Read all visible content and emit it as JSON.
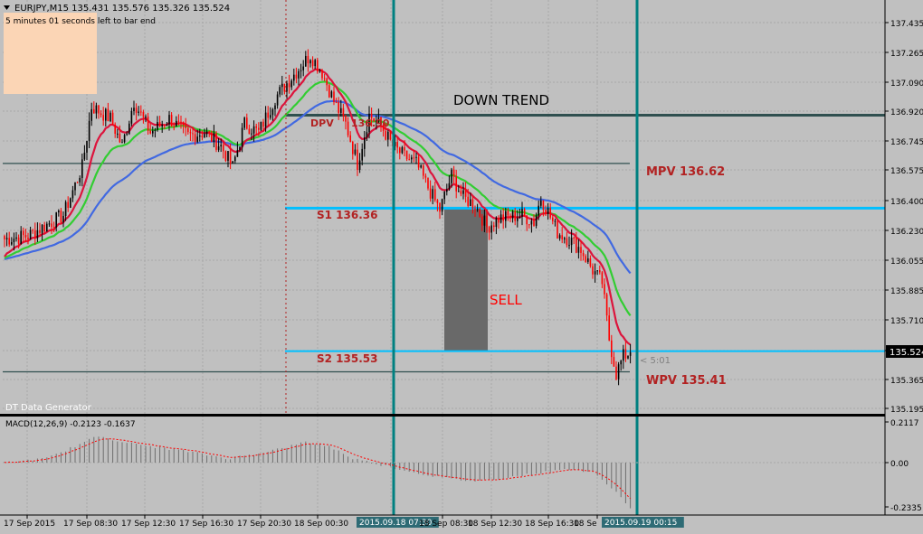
{
  "header": {
    "symbol_line": "EURJPY,M15  135.431 135.576 135.326 135.524",
    "bar_timer": "5 minutes 01 seconds left to bar end"
  },
  "labels": {
    "down_trend": "DOWN TREND",
    "sell": "SELL",
    "dpv": "DPV",
    "dpv_value": "136.90",
    "mpv": "MPV   136.62",
    "s1": "S1   136.36",
    "s2": "S2   135.53",
    "wpv": "WPV   135.41",
    "countdown": "< 5:01",
    "data_generator": "DT Data Generator",
    "current_price": "135.524"
  },
  "macd": {
    "label": "MACD(12,26,9) -0.2123 -0.1637",
    "ticks": [
      "0.2117",
      "0.00",
      "-0.2335"
    ]
  },
  "colors": {
    "background": "#c0c0c0",
    "bull_candle": "#000000",
    "bear_candle": "#ff0000",
    "ema_fast": "#dc143c",
    "ema_mid": "#32cd32",
    "ema_slow": "#4169e1",
    "level_cyan": "#00bfff",
    "level_dark": "#2f4f4f",
    "vline_teal": "#008080",
    "label_red": "#b22222",
    "sell_box": "#696969",
    "timer_box": "#fbd5b5"
  },
  "chart_data": {
    "type": "candlestick",
    "symbol": "EURJPY",
    "timeframe": "M15",
    "ylim": [
      135.195,
      137.52
    ],
    "y_ticks": [
      "137.435",
      "137.265",
      "137.090",
      "136.920",
      "136.745",
      "136.575",
      "136.400",
      "136.230",
      "136.055",
      "135.885",
      "135.710",
      "135.540",
      "135.365",
      "135.195"
    ],
    "x_ticks": [
      "17 Sep 2015",
      "17 Sep 08:30",
      "17 Sep 12:30",
      "17 Sep 16:30",
      "17 Sep 20:30",
      "18 Sep 00:30",
      "2015.09.18 07:30",
      "18 Sep 08:30",
      "18 Sep 12:30",
      "18 Sep 16:30",
      "18 Se",
      "2015.09.19 00:15"
    ],
    "close_anchors": [
      [
        0,
        136.18
      ],
      [
        10,
        136.2
      ],
      [
        25,
        136.32
      ],
      [
        33,
        136.6
      ],
      [
        37,
        136.95
      ],
      [
        45,
        136.88
      ],
      [
        50,
        136.72
      ],
      [
        55,
        136.98
      ],
      [
        62,
        136.8
      ],
      [
        70,
        136.88
      ],
      [
        78,
        136.78
      ],
      [
        85,
        136.8
      ],
      [
        92,
        136.72
      ],
      [
        97,
        136.6
      ],
      [
        102,
        136.85
      ],
      [
        108,
        136.8
      ],
      [
        115,
        137.0
      ],
      [
        122,
        137.12
      ],
      [
        130,
        137.25
      ],
      [
        135,
        137.15
      ],
      [
        140,
        136.98
      ],
      [
        145,
        136.85
      ],
      [
        150,
        136.62
      ],
      [
        155,
        136.9
      ],
      [
        160,
        136.84
      ],
      [
        165,
        136.72
      ],
      [
        170,
        136.66
      ],
      [
        175,
        136.62
      ],
      [
        180,
        136.48
      ],
      [
        185,
        136.35
      ],
      [
        190,
        136.55
      ],
      [
        195,
        136.42
      ],
      [
        200,
        136.38
      ],
      [
        205,
        136.25
      ],
      [
        210,
        136.3
      ],
      [
        220,
        136.32
      ],
      [
        225,
        136.28
      ],
      [
        228,
        136.42
      ],
      [
        231,
        136.34
      ],
      [
        235,
        136.22
      ],
      [
        240,
        136.18
      ],
      [
        245,
        136.12
      ],
      [
        250,
        136.0
      ],
      [
        254,
        135.93
      ],
      [
        257,
        135.6
      ],
      [
        260,
        135.4
      ],
      [
        263,
        135.5
      ],
      [
        266,
        135.524
      ]
    ],
    "macd_anchors": [
      [
        0,
        0.0
      ],
      [
        18,
        0.02
      ],
      [
        40,
        0.13
      ],
      [
        55,
        0.09
      ],
      [
        75,
        0.06
      ],
      [
        95,
        0.02
      ],
      [
        105,
        0.04
      ],
      [
        118,
        0.07
      ],
      [
        128,
        0.1
      ],
      [
        138,
        0.08
      ],
      [
        148,
        0.02
      ],
      [
        160,
        -0.01
      ],
      [
        175,
        -0.05
      ],
      [
        190,
        -0.08
      ],
      [
        200,
        -0.09
      ],
      [
        215,
        -0.07
      ],
      [
        228,
        -0.05
      ],
      [
        240,
        -0.03
      ],
      [
        250,
        -0.05
      ],
      [
        258,
        -0.12
      ],
      [
        266,
        -0.22
      ]
    ],
    "levels": {
      "DPV": 136.9,
      "MPV": 136.62,
      "S1": 136.36,
      "S2": 135.53,
      "WPV": 135.41
    },
    "sell_zone": {
      "price_top": 136.36,
      "price_bottom": 135.53
    }
  }
}
